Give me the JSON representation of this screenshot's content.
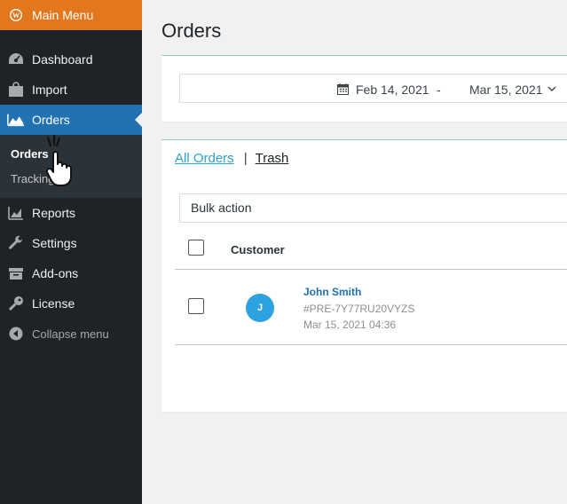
{
  "sidebar": {
    "top_label": "Main Menu",
    "items": [
      {
        "label": "Dashboard",
        "icon": "gauge-icon"
      },
      {
        "label": "Import",
        "icon": "bag-icon"
      },
      {
        "label": "Orders",
        "icon": "chart-area-icon"
      },
      {
        "label": "Reports",
        "icon": "reports-icon"
      },
      {
        "label": "Settings",
        "icon": "wrench-icon"
      },
      {
        "label": "Add-ons",
        "icon": "box-icon"
      },
      {
        "label": "License",
        "icon": "key-icon"
      },
      {
        "label": "Collapse menu",
        "icon": "collapse-icon"
      }
    ],
    "submenu": [
      {
        "label": "Orders"
      },
      {
        "label": "Tracking"
      }
    ],
    "colors": {
      "top": "#e2771e",
      "active": "#2271b1",
      "bg": "#1d2327"
    }
  },
  "page": {
    "title": "Orders"
  },
  "filters": {
    "date_from": "Feb 14, 2021",
    "separator": "-",
    "date_to": "Mar 15, 2021"
  },
  "tabs": {
    "all": "All Orders",
    "divider": "|",
    "trash": "Trash"
  },
  "bulk_action": {
    "selected": "Bulk action"
  },
  "table": {
    "headers": {
      "customer": "Customer"
    },
    "rows": [
      {
        "avatar_initial": "J",
        "name": "John Smith",
        "order_id": "#PRE-7Y77RU20VYZS",
        "date": "Mar 15, 2021 04:36"
      }
    ]
  }
}
